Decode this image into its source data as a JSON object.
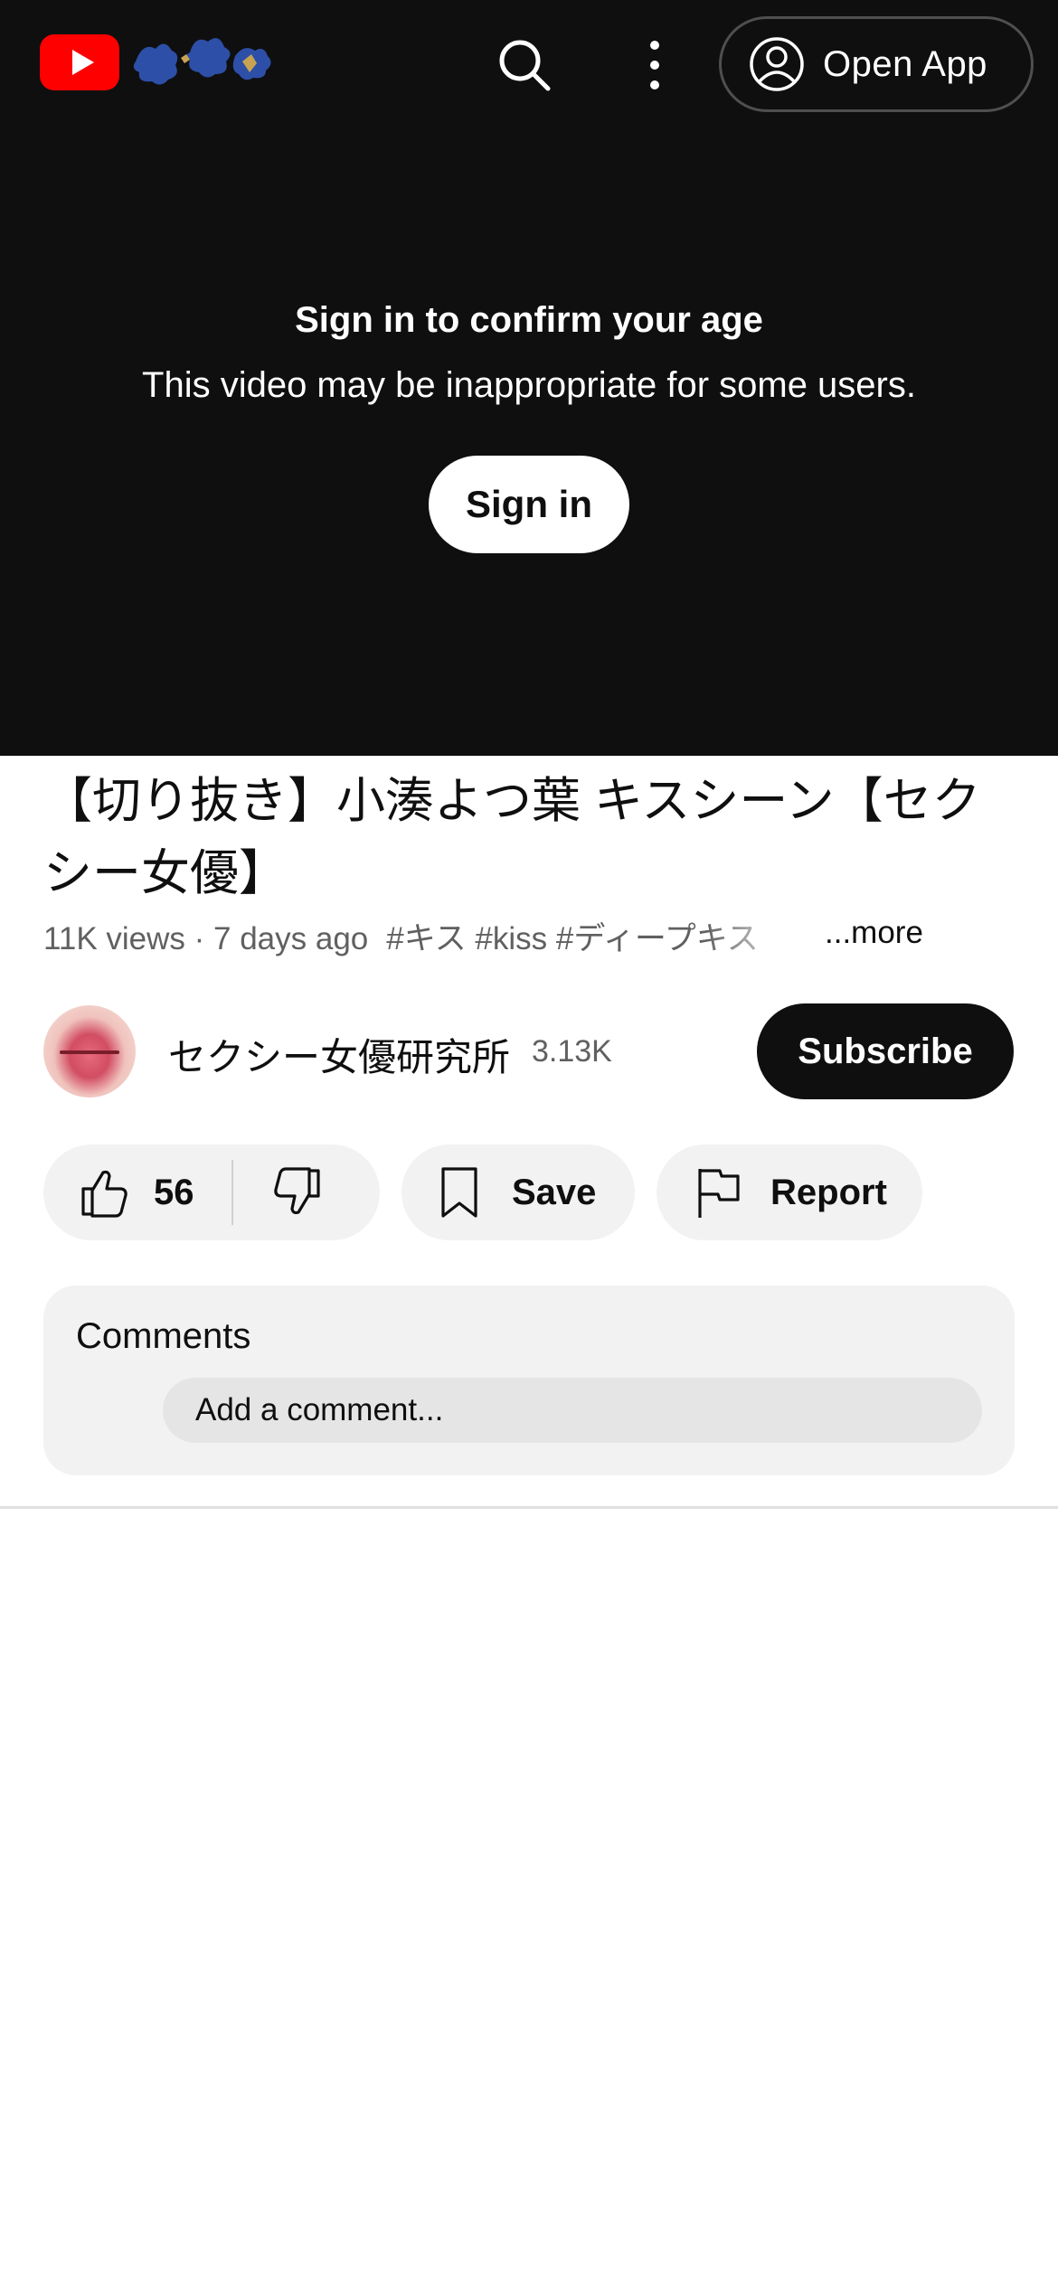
{
  "header": {
    "logo_icon": "youtube-play-icon",
    "doodle_icon": "seasonal-doodle-icon",
    "search_icon": "search-icon",
    "more_icon": "more-vertical-icon",
    "open_app_label": "Open App",
    "open_app_icon": "account-circle-icon"
  },
  "age_gate": {
    "title": "Sign in to confirm your age",
    "subtitle": "This video may be inappropriate for some users.",
    "sign_in_label": "Sign in"
  },
  "video": {
    "title": "【切り抜き】小湊よつ葉 キスシーン【セクシー女優】",
    "views_age": "11K views · 7 days ago",
    "tags": "#キス #kiss #ディープキス",
    "more_label": "...more"
  },
  "channel": {
    "name": "セクシー女優研究所",
    "subscribers": "3.13K",
    "subscribe_label": "Subscribe"
  },
  "actions": {
    "like_count": "56",
    "save_label": "Save",
    "report_label": "Report"
  },
  "comments": {
    "label": "Comments",
    "placeholder": "Add a comment..."
  },
  "colors": {
    "header_bg": "#0f0f0f",
    "brand_red": "#ff0000",
    "pill_bg": "#f2f2f2",
    "secondary_text": "#606060"
  }
}
